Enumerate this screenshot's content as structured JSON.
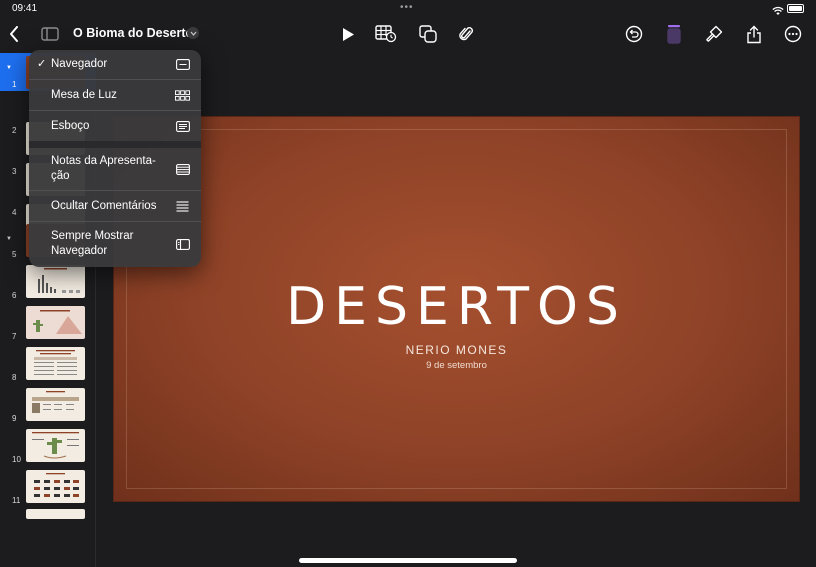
{
  "status": {
    "time": "09:41"
  },
  "toolbar": {
    "document_title": "O Bioma do Deserto",
    "accent_color": "#a06cf0"
  },
  "navigator": {
    "slides": [
      {
        "number": "1",
        "selected": true
      },
      {
        "number": "2"
      },
      {
        "number": "3"
      },
      {
        "number": "4"
      },
      {
        "number": "5"
      },
      {
        "number": "6"
      },
      {
        "number": "7"
      },
      {
        "number": "8"
      },
      {
        "number": "9"
      },
      {
        "number": "10"
      },
      {
        "number": "11"
      }
    ],
    "add_label": "+"
  },
  "menu": {
    "items": [
      {
        "label": "Navegador",
        "checked": true,
        "icon": "navigator-view-icon"
      },
      {
        "label": "Mesa de Luz",
        "icon": "light-table-grid-icon"
      },
      {
        "label": "Esboço",
        "icon": "outline-view-icon"
      },
      {
        "label": "Notas da Apresenta-ção",
        "icon": "presenter-notes-icon"
      },
      {
        "label": "Ocultar Comentários",
        "icon": "comments-lines-icon"
      },
      {
        "label": "Sempre Mostrar Navegador",
        "icon": "sidebar-panel-icon"
      }
    ],
    "check_mark": "✓"
  },
  "slide": {
    "title": "DESERTOS",
    "author": "NERIO MONES",
    "date": "9 de setembro",
    "background_color": "#8e4227"
  }
}
